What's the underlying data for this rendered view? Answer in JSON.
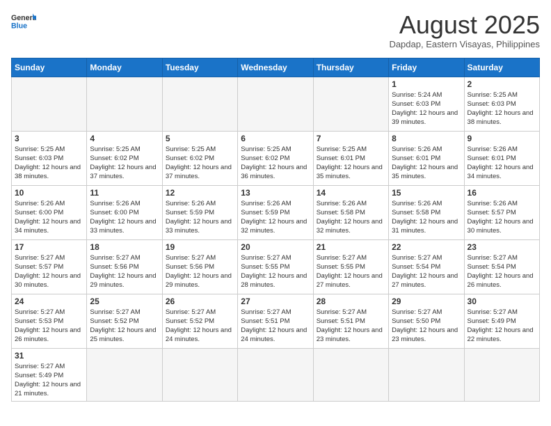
{
  "header": {
    "logo_general": "General",
    "logo_blue": "Blue",
    "month_title": "August 2025",
    "subtitle": "Dapdap, Eastern Visayas, Philippines"
  },
  "weekdays": [
    "Sunday",
    "Monday",
    "Tuesday",
    "Wednesday",
    "Thursday",
    "Friday",
    "Saturday"
  ],
  "weeks": [
    [
      {
        "day": "",
        "info": ""
      },
      {
        "day": "",
        "info": ""
      },
      {
        "day": "",
        "info": ""
      },
      {
        "day": "",
        "info": ""
      },
      {
        "day": "",
        "info": ""
      },
      {
        "day": "1",
        "info": "Sunrise: 5:24 AM\nSunset: 6:03 PM\nDaylight: 12 hours and 39 minutes."
      },
      {
        "day": "2",
        "info": "Sunrise: 5:25 AM\nSunset: 6:03 PM\nDaylight: 12 hours and 38 minutes."
      }
    ],
    [
      {
        "day": "3",
        "info": "Sunrise: 5:25 AM\nSunset: 6:03 PM\nDaylight: 12 hours and 38 minutes."
      },
      {
        "day": "4",
        "info": "Sunrise: 5:25 AM\nSunset: 6:02 PM\nDaylight: 12 hours and 37 minutes."
      },
      {
        "day": "5",
        "info": "Sunrise: 5:25 AM\nSunset: 6:02 PM\nDaylight: 12 hours and 37 minutes."
      },
      {
        "day": "6",
        "info": "Sunrise: 5:25 AM\nSunset: 6:02 PM\nDaylight: 12 hours and 36 minutes."
      },
      {
        "day": "7",
        "info": "Sunrise: 5:25 AM\nSunset: 6:01 PM\nDaylight: 12 hours and 35 minutes."
      },
      {
        "day": "8",
        "info": "Sunrise: 5:26 AM\nSunset: 6:01 PM\nDaylight: 12 hours and 35 minutes."
      },
      {
        "day": "9",
        "info": "Sunrise: 5:26 AM\nSunset: 6:01 PM\nDaylight: 12 hours and 34 minutes."
      }
    ],
    [
      {
        "day": "10",
        "info": "Sunrise: 5:26 AM\nSunset: 6:00 PM\nDaylight: 12 hours and 34 minutes."
      },
      {
        "day": "11",
        "info": "Sunrise: 5:26 AM\nSunset: 6:00 PM\nDaylight: 12 hours and 33 minutes."
      },
      {
        "day": "12",
        "info": "Sunrise: 5:26 AM\nSunset: 5:59 PM\nDaylight: 12 hours and 33 minutes."
      },
      {
        "day": "13",
        "info": "Sunrise: 5:26 AM\nSunset: 5:59 PM\nDaylight: 12 hours and 32 minutes."
      },
      {
        "day": "14",
        "info": "Sunrise: 5:26 AM\nSunset: 5:58 PM\nDaylight: 12 hours and 32 minutes."
      },
      {
        "day": "15",
        "info": "Sunrise: 5:26 AM\nSunset: 5:58 PM\nDaylight: 12 hours and 31 minutes."
      },
      {
        "day": "16",
        "info": "Sunrise: 5:26 AM\nSunset: 5:57 PM\nDaylight: 12 hours and 30 minutes."
      }
    ],
    [
      {
        "day": "17",
        "info": "Sunrise: 5:27 AM\nSunset: 5:57 PM\nDaylight: 12 hours and 30 minutes."
      },
      {
        "day": "18",
        "info": "Sunrise: 5:27 AM\nSunset: 5:56 PM\nDaylight: 12 hours and 29 minutes."
      },
      {
        "day": "19",
        "info": "Sunrise: 5:27 AM\nSunset: 5:56 PM\nDaylight: 12 hours and 29 minutes."
      },
      {
        "day": "20",
        "info": "Sunrise: 5:27 AM\nSunset: 5:55 PM\nDaylight: 12 hours and 28 minutes."
      },
      {
        "day": "21",
        "info": "Sunrise: 5:27 AM\nSunset: 5:55 PM\nDaylight: 12 hours and 27 minutes."
      },
      {
        "day": "22",
        "info": "Sunrise: 5:27 AM\nSunset: 5:54 PM\nDaylight: 12 hours and 27 minutes."
      },
      {
        "day": "23",
        "info": "Sunrise: 5:27 AM\nSunset: 5:54 PM\nDaylight: 12 hours and 26 minutes."
      }
    ],
    [
      {
        "day": "24",
        "info": "Sunrise: 5:27 AM\nSunset: 5:53 PM\nDaylight: 12 hours and 26 minutes."
      },
      {
        "day": "25",
        "info": "Sunrise: 5:27 AM\nSunset: 5:52 PM\nDaylight: 12 hours and 25 minutes."
      },
      {
        "day": "26",
        "info": "Sunrise: 5:27 AM\nSunset: 5:52 PM\nDaylight: 12 hours and 24 minutes."
      },
      {
        "day": "27",
        "info": "Sunrise: 5:27 AM\nSunset: 5:51 PM\nDaylight: 12 hours and 24 minutes."
      },
      {
        "day": "28",
        "info": "Sunrise: 5:27 AM\nSunset: 5:51 PM\nDaylight: 12 hours and 23 minutes."
      },
      {
        "day": "29",
        "info": "Sunrise: 5:27 AM\nSunset: 5:50 PM\nDaylight: 12 hours and 23 minutes."
      },
      {
        "day": "30",
        "info": "Sunrise: 5:27 AM\nSunset: 5:49 PM\nDaylight: 12 hours and 22 minutes."
      }
    ],
    [
      {
        "day": "31",
        "info": "Sunrise: 5:27 AM\nSunset: 5:49 PM\nDaylight: 12 hours and 21 minutes."
      },
      {
        "day": "",
        "info": ""
      },
      {
        "day": "",
        "info": ""
      },
      {
        "day": "",
        "info": ""
      },
      {
        "day": "",
        "info": ""
      },
      {
        "day": "",
        "info": ""
      },
      {
        "day": "",
        "info": ""
      }
    ]
  ]
}
